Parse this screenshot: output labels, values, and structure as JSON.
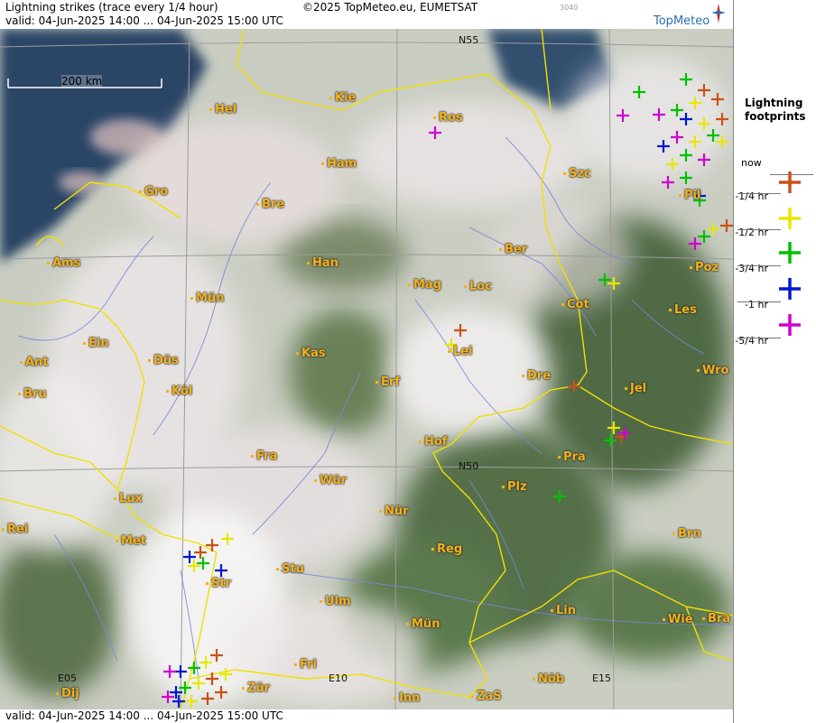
{
  "header": {
    "title": "Lightning strikes (trace every 1/4 hour)",
    "copyright": "©2025 TopMeteo.eu, EUMETSAT",
    "code": "3040",
    "valid": "valid:  04-Jun-2025 14:00 ... 04-Jun-2025 15:00 UTC",
    "logo_text": "TopMeteo"
  },
  "footer": {
    "valid": "valid:  04-Jun-2025 14:00 ... 04-Jun-2025 15:00 UTC"
  },
  "scale": {
    "label": "200 km"
  },
  "grid_labels": {
    "n55": "N55",
    "n50": "N50",
    "e05": "E05",
    "e10": "E10",
    "e15": "E15"
  },
  "cities": [
    "Hel",
    "Kie",
    "Ros",
    "Ham",
    "Szc",
    "Gro",
    "Bre",
    "Ber",
    "Pil",
    "Ams",
    "Han",
    "Mag",
    "Loc",
    "Poz",
    "Mün",
    "Cot",
    "Les",
    "Ein",
    "Kas",
    "Lei",
    "Ant",
    "Düs",
    "Wro",
    "Bru",
    "Köl",
    "Erf",
    "Dre",
    "Jel",
    "Hof",
    "Fra",
    "Pra",
    "Lux",
    "Wür",
    "Plz",
    "Rei",
    "Nür",
    "Met",
    "Brn",
    "Reg",
    "Stu",
    "Str",
    "Ulm",
    "Lin",
    "Wie",
    "Bra",
    "Mün",
    "Fri",
    "Dij",
    "Zür",
    "Inn",
    "ZaS",
    "Nöb"
  ],
  "legend": {
    "title_line1": "Lightning",
    "title_line2": "footprints",
    "rows": [
      {
        "label": "now",
        "color": "#c8521a"
      },
      {
        "label": "-1/4 hr",
        "color": "#e8e800"
      },
      {
        "label": "-1/2 hr",
        "color": "#00c000"
      },
      {
        "label": "-3/4 hr",
        "color": "#0018d0"
      },
      {
        "label": "-1 hr",
        "color": "#d000d0"
      },
      {
        "label": "-5/4 hr",
        "color": ""
      }
    ]
  },
  "colors": {
    "border": "#f0e000",
    "river": "#7a86d8",
    "gridline": "#9c9c9c",
    "city": "#f3b11a",
    "sea": "#26415e"
  }
}
